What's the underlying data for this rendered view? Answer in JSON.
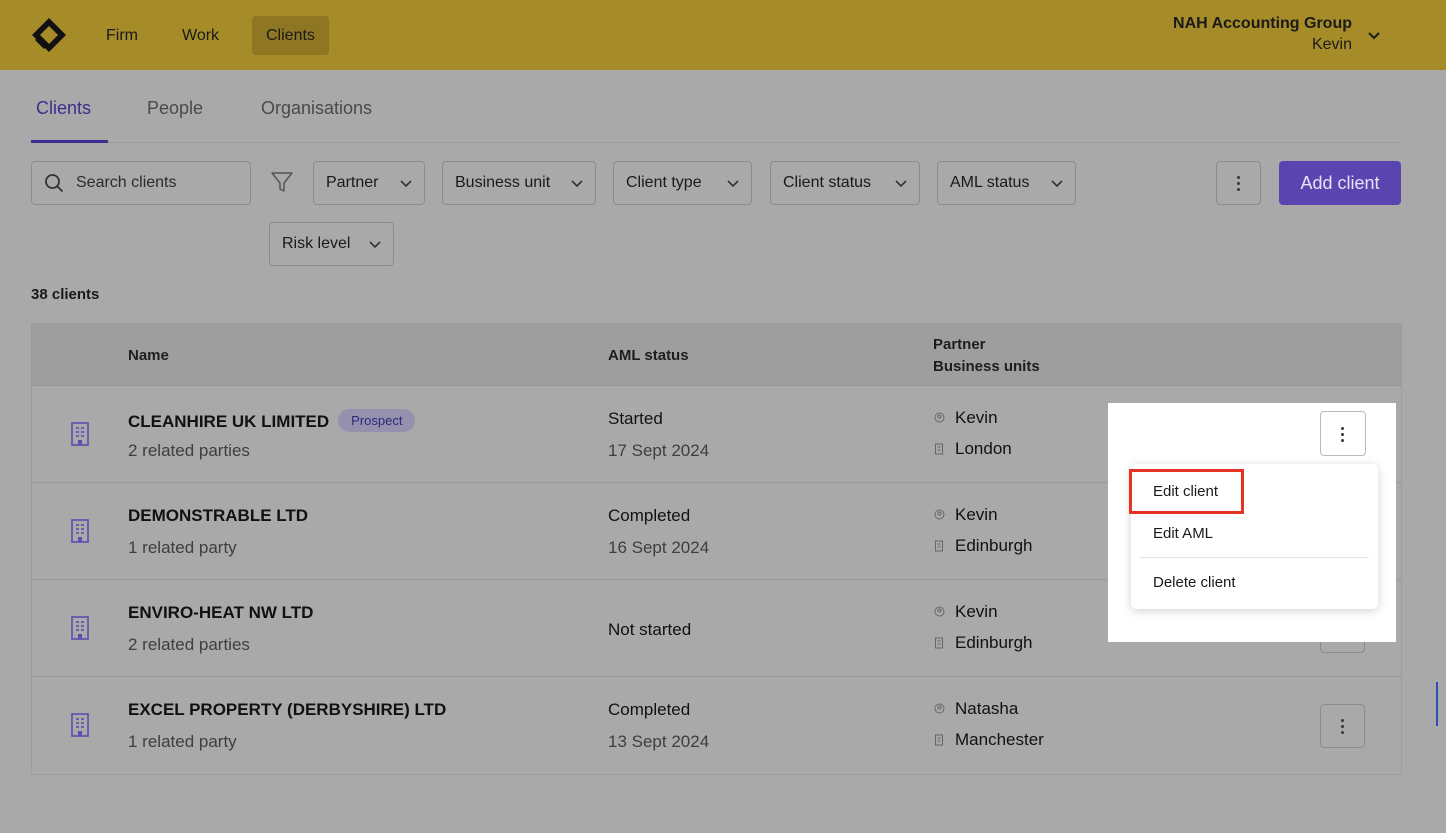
{
  "nav": {
    "items": [
      {
        "label": "Firm"
      },
      {
        "label": "Work"
      },
      {
        "label": "Clients"
      }
    ],
    "org_name": "NAH Accounting Group",
    "user_name": "Kevin"
  },
  "tabs": [
    {
      "label": "Clients"
    },
    {
      "label": "People"
    },
    {
      "label": "Organisations"
    }
  ],
  "filters": {
    "search_placeholder": "Search clients",
    "dropdowns": [
      "Partner",
      "Business unit",
      "Client type",
      "Client status",
      "AML status",
      "Risk level"
    ],
    "add_label": "Add client"
  },
  "count_label": "38 clients",
  "table": {
    "headers": {
      "name": "Name",
      "aml": "AML status",
      "partner": "Partner",
      "business_units": "Business units"
    },
    "rows": [
      {
        "name": "CLEANHIRE UK LIMITED",
        "badge": "Prospect",
        "related": "2 related parties",
        "aml_status": "Started",
        "aml_date": "17 Sept 2024",
        "partner": "Kevin",
        "unit": "London"
      },
      {
        "name": "DEMONSTRABLE LTD",
        "badge": "",
        "related": "1 related party",
        "aml_status": "Completed",
        "aml_date": "16 Sept 2024",
        "partner": "Kevin",
        "unit": "Edinburgh"
      },
      {
        "name": "ENVIRO-HEAT NW LTD",
        "badge": "",
        "related": "2 related parties",
        "aml_status": "Not started",
        "aml_date": "",
        "partner": "Kevin",
        "unit": "Edinburgh"
      },
      {
        "name": "EXCEL PROPERTY (DERBYSHIRE) LTD",
        "badge": "",
        "related": "1 related party",
        "aml_status": "Completed",
        "aml_date": "13 Sept 2024",
        "partner": "Natasha",
        "unit": "Manchester"
      }
    ]
  },
  "context_menu": {
    "items": [
      "Edit client",
      "Edit AML",
      "Delete client"
    ]
  },
  "colors": {
    "header_bg": "#a68c29",
    "accent": "#5a45b0",
    "highlight": "#e53423"
  }
}
